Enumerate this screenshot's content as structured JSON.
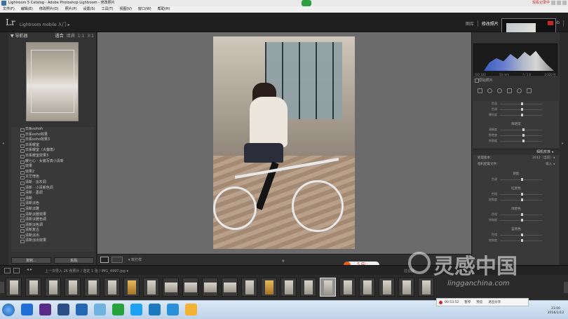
{
  "window": {
    "title": "Lightroom 5 Catalog - Adobe Photoshop Lightroom - 修改照片",
    "overlay_red_text": "观看记录中"
  },
  "menu": [
    "文件(F)",
    "编辑(E)",
    "修改照片(D)",
    "照片(P)",
    "设置(S)",
    "工具(T)",
    "视图(V)",
    "窗口(W)",
    "帮助(H)"
  ],
  "identity": {
    "logo": "Lr",
    "mobile_label": "Lightroom mobile 入门 ▸"
  },
  "modules": [
    {
      "label": "图库",
      "active": false
    },
    {
      "label": "修改照片",
      "active": true
    },
    {
      "label": "地图",
      "active": false
    },
    {
      "label": "画册",
      "active": false
    },
    {
      "label": "幻",
      "active": false
    },
    {
      "label": "Web",
      "active": false
    }
  ],
  "navigator": {
    "title": "▼ 导航器",
    "options": [
      {
        "label": "适合",
        "active": true
      },
      {
        "label": "填满",
        "active": false
      },
      {
        "label": "1:1",
        "active": false
      },
      {
        "label": "3:1",
        "active": false
      }
    ]
  },
  "presets": [
    "日系sohoh",
    "日系soho效果",
    "日系soho效果3",
    "日系暖室",
    "日系暖室（大偏角）",
    "日系暖室效果3",
    "暖七心 · 女装写真小清新",
    "效果",
    "效果2",
    "文艺悖色",
    "清新 · 淡灰调",
    "清新 · 小清新色调",
    "清新 · 墨调",
    "清新",
    "清新淡色",
    "清新淡雅",
    "清新淡雅效果",
    "清新淡雅色调",
    "清新淡色调",
    "清新复古",
    "清新淡出",
    "清新淡出效果"
  ],
  "left_buttons": {
    "copy": "复制...",
    "paste": "粘贴"
  },
  "toolbar": {
    "softproof": "▾ 软打样"
  },
  "center_badge": "5 中 ·",
  "histogram": {
    "readout": [
      "ISO 100",
      "50 mm",
      "f / 1.8",
      "1/320 秒"
    ],
    "original_photo": "原始照片"
  },
  "basic_sliders": [
    {
      "label": "色温",
      "value": ""
    },
    {
      "label": "色调",
      "value": ""
    },
    {
      "label": "曝光度",
      "value": ""
    }
  ],
  "basic_sliders_2": [
    {
      "label": "清晰度",
      "value": ""
    },
    {
      "label": "鲜艳度",
      "value": ""
    },
    {
      "label": "饱和度",
      "value": ""
    }
  ],
  "presence_label": "鲜艳度",
  "camera_calibration": {
    "header": "相机校准 ◂",
    "process_label": "处理版本：",
    "process_value": "2012（当前）◂",
    "profile_label": "相机配置文件：",
    "profile_value": "嵌入 ◂"
  },
  "calibration_groups": [
    {
      "title": "阴影",
      "rows": [
        {
          "label": "色调"
        }
      ]
    },
    {
      "title": "红原色",
      "rows": [
        {
          "label": "色相"
        },
        {
          "label": "饱和度"
        }
      ]
    },
    {
      "title": "绿原色",
      "rows": [
        {
          "label": "色相"
        },
        {
          "label": "饱和度"
        }
      ]
    },
    {
      "title": "蓝原色",
      "rows": [
        {
          "label": "色相"
        },
        {
          "label": "饱和度"
        }
      ]
    }
  ],
  "filmbar": {
    "nav": "◂ ▸",
    "path": "上一次导入   26 张照片 / 选定 1 张 / IMG_4997.jpg ▾",
    "filter_label": "过滤器："
  },
  "filmstrip": {
    "count": 22,
    "selected_index": 16
  },
  "watermark": {
    "title": "灵感中国",
    "url": "lingganchina.com"
  },
  "taskbar": {
    "tray_items": [
      "00:53:52",
      "暂停",
      "预览",
      "退出分享"
    ],
    "time": "23:00",
    "date": "2016/1/13",
    "icon_colors": [
      "#1f6fd6",
      "#5a2c89",
      "#2b4e87",
      "#2468b5",
      "#6db2e0",
      "#26a33a",
      "#1da1f2",
      "#1c79c0",
      "#2a8fd9",
      "#f2b233"
    ]
  }
}
